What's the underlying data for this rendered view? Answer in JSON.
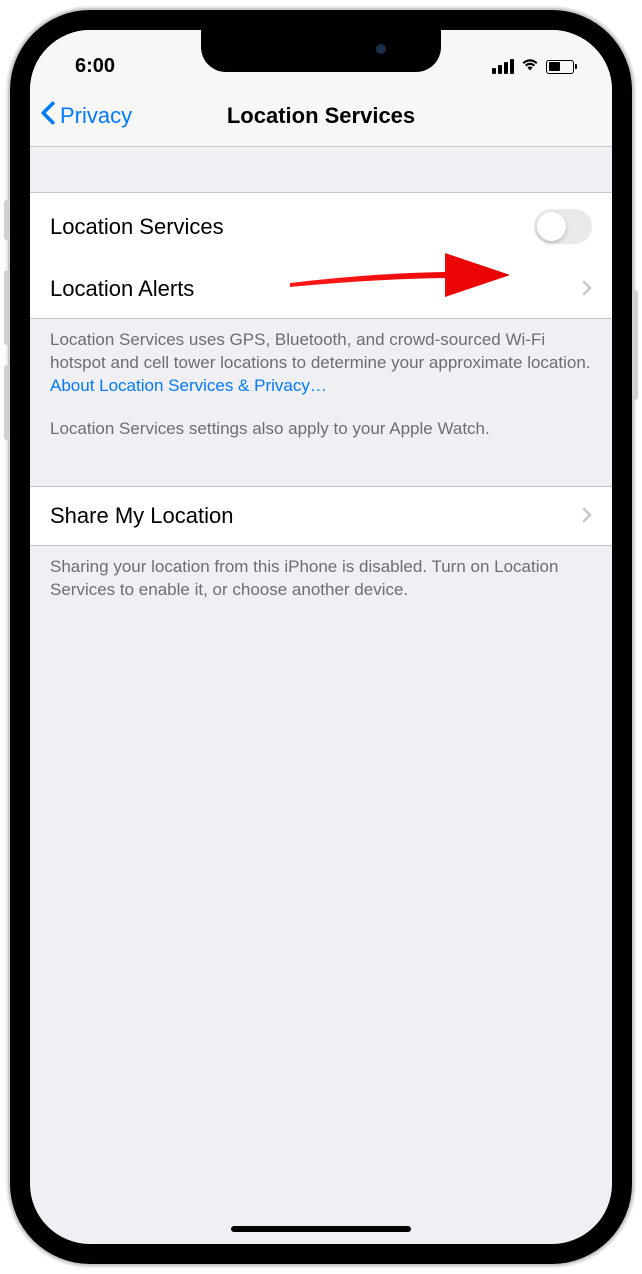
{
  "statusBar": {
    "time": "6:00"
  },
  "navBar": {
    "backLabel": "Privacy",
    "title": "Location Services"
  },
  "rows": {
    "locationServices": {
      "label": "Location Services",
      "toggleOn": false
    },
    "locationAlerts": {
      "label": "Location Alerts"
    },
    "shareMyLocation": {
      "label": "Share My Location"
    }
  },
  "footers": {
    "locServicesDesc": "Location Services uses GPS, Bluetooth, and crowd-sourced Wi-Fi hotspot and cell tower locations to determine your approximate location. ",
    "locServicesLink": "About Location Services & Privacy…",
    "appleWatchNote": "Location Services settings also apply to your Apple Watch.",
    "shareDesc": "Sharing your location from this iPhone is disabled. Turn on Location Services to enable it, or choose another device."
  }
}
